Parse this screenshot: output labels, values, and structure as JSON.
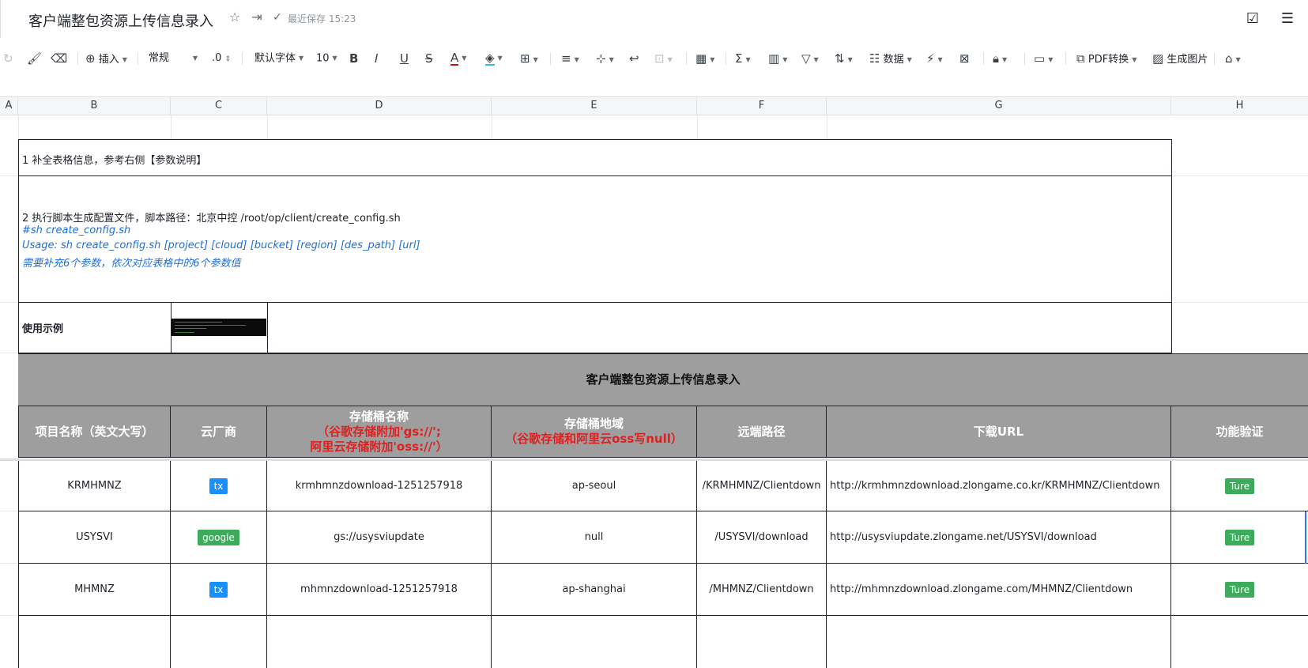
{
  "titlebar": {
    "title": "客户端整包资源上传信息录入",
    "save_status": "最近保存 15:23"
  },
  "toolbar": {
    "insert_label": "插入",
    "format_label": "常规",
    "decimal_label": ".0",
    "font_label": "默认字体",
    "size_label": "10",
    "data_label": "数据",
    "pdf_label": "PDF转换",
    "image_label": "生成图片"
  },
  "columns": [
    "A",
    "B",
    "C",
    "D",
    "E",
    "F",
    "G",
    "H"
  ],
  "notes": {
    "step1": "1 补全表格信息，参考右侧【参数说明】",
    "step2": "2 执行脚本生成配置文件，脚本路径：北京中控  /root/op/client/create_config.sh",
    "cmd": "#sh create_config.sh",
    "usage": "Usage: sh create_config.sh [project] [cloud] [bucket] [region] [des_path] [url]",
    "hint": "需要补充6个参数，依次对应表格中的6个参数值",
    "example_label": "使用示例"
  },
  "table": {
    "banner": "客户端整包资源上传信息录入",
    "headers": {
      "project": "项目名称（英文大写）",
      "cloud": "云厂商",
      "bucket": "存储桶名称",
      "bucket_note_1": "（谷歌存储附加'gs://';",
      "bucket_note_2": "阿里云存储附加'oss://'）",
      "region": "存储桶地域",
      "region_note": "（谷歌存储和阿里云oss写null）",
      "path": "远端路径",
      "url": "下载URL",
      "verify": "功能验证"
    },
    "rows": [
      {
        "project": "KRMHMNZ",
        "cloud": "tx",
        "bucket": "krmhmnzdownload-1251257918",
        "region": "ap-seoul",
        "path": "/KRMHMNZ/Clientdown",
        "url": "http://krmhmnzdownload.zlongame.co.kr/KRMHMNZ/Clientdown",
        "verify": "Ture"
      },
      {
        "project": "USYSVI",
        "cloud": "google",
        "bucket": "gs://usysviupdate",
        "region": "null",
        "path": "/USYSVI/download",
        "url": "http://usysviupdate.zlongame.net/USYSVI/download",
        "verify": "Ture"
      },
      {
        "project": "MHMNZ",
        "cloud": "tx",
        "bucket": "mhmnzdownload-1251257918",
        "region": "ap-shanghai",
        "path": "/MHMNZ/Clientdown",
        "url": "http://mhmnzdownload.zlongame.com/MHMNZ/Clientdown",
        "verify": "Ture"
      }
    ]
  },
  "colors": {
    "header_bg": "#9e9e9e",
    "tag_tx": "#1890ff",
    "tag_google": "#3daa5c",
    "tag_verify": "#3daa5c",
    "note_blue": "#1e6fd9",
    "header_red": "#e02020"
  }
}
